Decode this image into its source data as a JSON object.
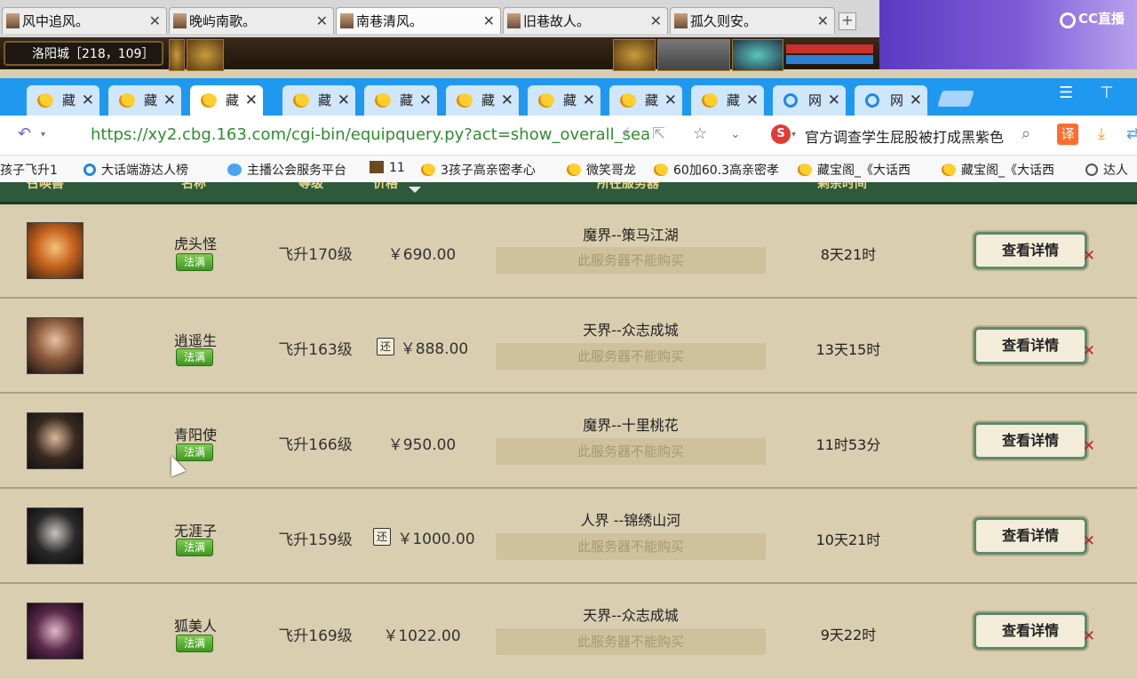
{
  "game_tabs": [
    {
      "label": "风中追风。",
      "active": false
    },
    {
      "label": "晚屿南歌。",
      "active": false
    },
    {
      "label": "南巷清风。",
      "active": true
    },
    {
      "label": "旧巷故人。",
      "active": false
    },
    {
      "label": "孤久则安。",
      "active": false
    }
  ],
  "game_hud": {
    "location": "洛阳城［218，109］"
  },
  "stream": {
    "logo": "CC直播"
  },
  "browser_tabs": [
    {
      "label": "藏",
      "icon": "chick-icon"
    },
    {
      "label": "藏",
      "icon": "chick-icon"
    },
    {
      "label": "藏",
      "icon": "chick-icon",
      "active": true
    },
    {
      "label": "藏",
      "icon": "chick-icon"
    },
    {
      "label": "藏",
      "icon": "chick-icon"
    },
    {
      "label": "藏",
      "icon": "chick-icon"
    },
    {
      "label": "藏",
      "icon": "chick-icon"
    },
    {
      "label": "藏",
      "icon": "chick-icon"
    },
    {
      "label": "藏",
      "icon": "chick-icon"
    },
    {
      "label": "网",
      "icon": "ie-icon"
    },
    {
      "label": "网",
      "icon": "ie-icon"
    }
  ],
  "address": {
    "url": "https://xy2.cbg.163.com/cgi-bin/equipquery.py?act=show_overall_sea",
    "news": "官方调查学生屁股被打成黑紫色",
    "translate": "译"
  },
  "bookmarks": [
    {
      "label": "孩子飞升1",
      "icon": "none"
    },
    {
      "label": "大话端游达人榜",
      "icon": "ie"
    },
    {
      "label": "主播公会服务平台",
      "icon": "blue"
    },
    {
      "label": "11",
      "icon": "game"
    },
    {
      "label": "3孩子高亲密孝心",
      "icon": "chick"
    },
    {
      "label": "微笑哥龙",
      "icon": "chick"
    },
    {
      "label": "60加60.3高亲密孝",
      "icon": "chick"
    },
    {
      "label": "藏宝阁_《大话西",
      "icon": "chick"
    },
    {
      "label": "藏宝阁_《大话西",
      "icon": "chick"
    },
    {
      "label": "达人",
      "icon": "globe"
    }
  ],
  "table": {
    "headers": [
      "召唤兽",
      "名称",
      "等级",
      "价格",
      "所在服务器",
      "剩余时间"
    ],
    "rows": [
      {
        "name": "虎头怪",
        "badge": "法满",
        "level": "飞升170级",
        "huan": "",
        "price": "￥690.00",
        "server": "魔界--策马江湖",
        "nobuy": "此服务器不能购买",
        "time": "8天21时",
        "button": "查看详情",
        "avatar": "tiger"
      },
      {
        "name": "逍遥生",
        "badge": "法满",
        "level": "飞升163级",
        "huan": "还",
        "price": "￥888.00",
        "server": "天界--众志成城",
        "nobuy": "此服务器不能购买",
        "time": "13天15时",
        "button": "查看详情",
        "avatar": "man"
      },
      {
        "name": "青阳使",
        "badge": "法满",
        "level": "飞升166级",
        "huan": "",
        "price": "￥950.00",
        "server": "魔界--十里桃花",
        "nobuy": "此服务器不能购买",
        "time": "11时53分",
        "button": "查看详情",
        "avatar": "elf"
      },
      {
        "name": "无涯子",
        "badge": "法满",
        "level": "飞升159级",
        "huan": "还",
        "price": "￥1000.00",
        "server": "人界 --锦绣山河",
        "nobuy": "此服务器不能购买",
        "time": "10天21时",
        "button": "查看详情",
        "avatar": "ghost"
      },
      {
        "name": "狐美人",
        "badge": "法满",
        "level": "飞升169级",
        "huan": "",
        "price": "￥1022.00",
        "server": "天界--众志成城",
        "nobuy": "此服务器不能购买",
        "time": "9天22时",
        "button": "查看详情",
        "avatar": "fox"
      }
    ]
  },
  "colors": {
    "accent_green": "#2d5a3a",
    "badge_green": "#5bb33a",
    "browser_blue": "#1f98f0"
  }
}
